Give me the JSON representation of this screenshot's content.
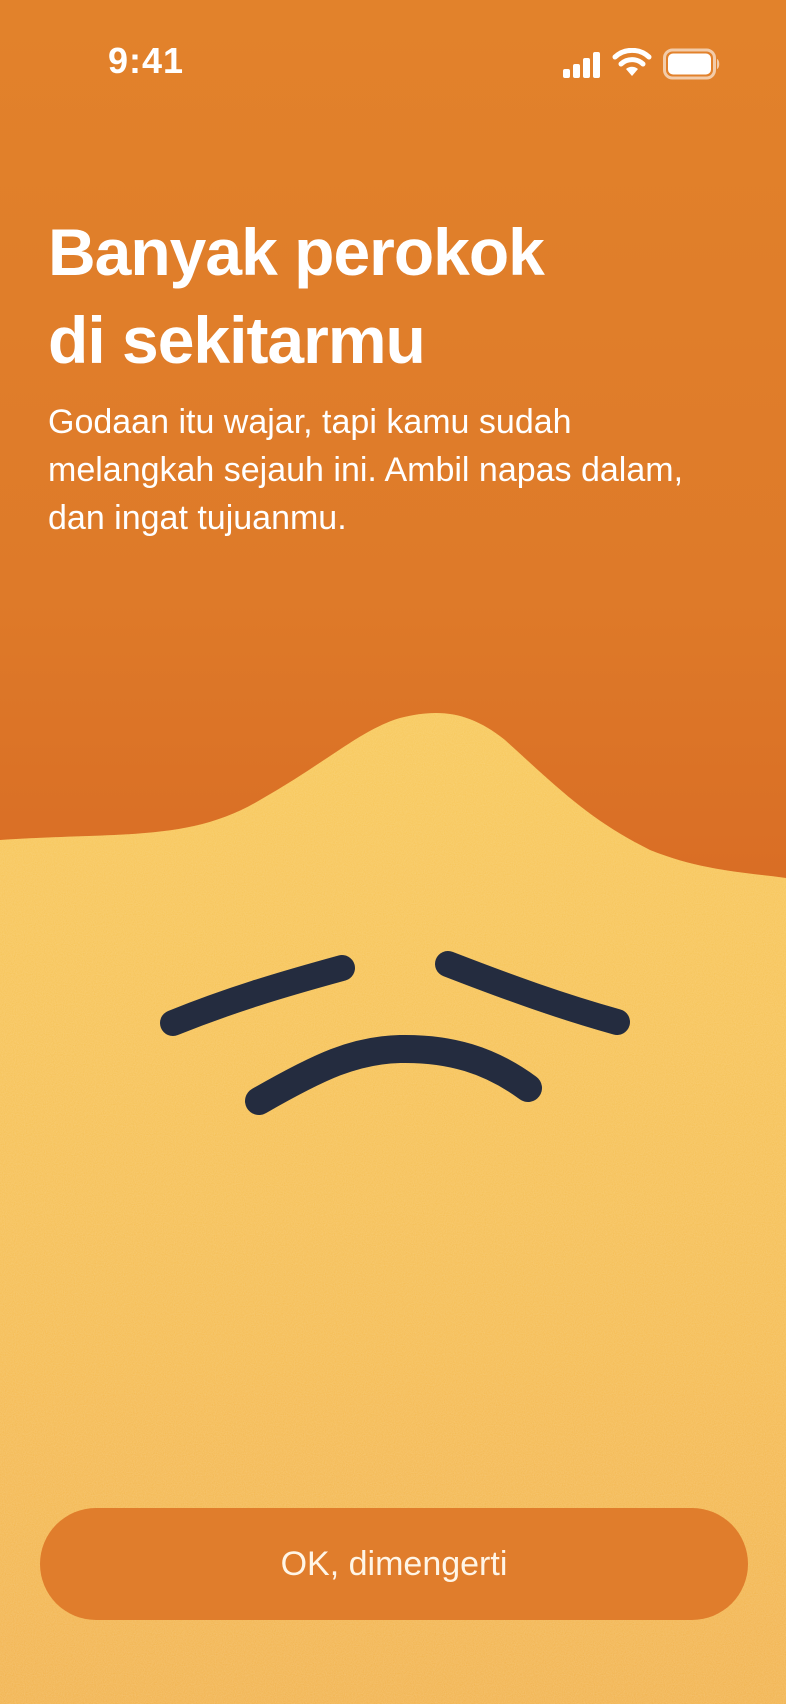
{
  "status_bar": {
    "time": "9:41",
    "icons": [
      "signal-icon",
      "wifi-icon",
      "battery-icon"
    ]
  },
  "headline": {
    "line1": "Banyak perokok",
    "line2": "di sekitarmu"
  },
  "message": {
    "line1": "Godaan itu wajar, tapi kamu sudah",
    "line2": "melangkah sejauh ini. Ambil napas dalam,",
    "line3": "dan ingat tujuanmu."
  },
  "illustration": {
    "name": "worried-face",
    "face_color": "#f6c252"
  },
  "button": {
    "label": "OK, dimengerti"
  },
  "colors": {
    "background_top": "#e2822b",
    "background_mid": "#d66624",
    "blob": "#f6c252",
    "face_features": "#242c3f",
    "button": "#e07d2c",
    "text": "#ffffff"
  }
}
